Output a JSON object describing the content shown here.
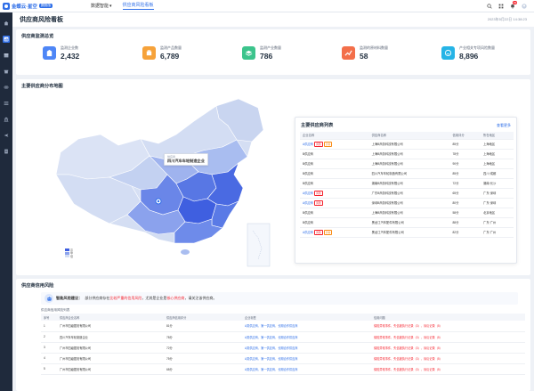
{
  "app": {
    "brand_name": "金蝶云·星空",
    "brand_tag": "旗舰版",
    "nav": [
      {
        "label": "数据智能"
      },
      {
        "label": "供应商风险看板"
      }
    ]
  },
  "header": {
    "title": "供应商风险看板",
    "timestamp": "2023年5月22日 14:38:23",
    "notification_count": "99"
  },
  "overview": {
    "title": "供应商监测总览",
    "stats": [
      {
        "label": "监测企业数",
        "value": "2,432",
        "color": "#4e86f6"
      },
      {
        "label": "监测产品数量",
        "value": "6,789",
        "color": "#f6a23a"
      },
      {
        "label": "监测产业数量",
        "value": "786",
        "color": "#3cc48c"
      },
      {
        "label": "监测的原材料数量",
        "value": "58",
        "color": "#f36f4a"
      },
      {
        "label": "产业相关专项风险数量",
        "value": "8,896",
        "color": "#26b4e6"
      }
    ]
  },
  "map": {
    "title": "主要供应商分布地图",
    "tooltip_title": "供应商",
    "tooltip_name": "四川汽车车轮制造企业",
    "legend": [
      "高",
      "中",
      "低"
    ]
  },
  "supplier_list": {
    "title": "主要供应商列表",
    "more": "查看更多",
    "columns": [
      "企业名称",
      "供应商名称",
      "信用评分",
      "所在地区"
    ],
    "rows": [
      {
        "name": "A供应商",
        "tags": [
          {
            "t": "风险",
            "c": "red"
          },
          {
            "t": "异常",
            "c": "orange"
          }
        ],
        "supplier": "上海B商务科技有限公司",
        "score": "85分",
        "region": "上海地区"
      },
      {
        "name": "B供应商",
        "tags": [],
        "supplier": "上海B商务科技有限公司",
        "score": "78分",
        "region": "上海地区"
      },
      {
        "name": "B供应商",
        "tags": [],
        "supplier": "上海B商务科技有限公司",
        "score": "90分",
        "region": "上海地区"
      },
      {
        "name": "B供应商",
        "tags": [],
        "supplier": "四川汽车车轮制造有限公司",
        "score": "85分",
        "region": "四川·成都"
      },
      {
        "name": "B供应商",
        "tags": [],
        "supplier": "湖南B商务科技有限公司",
        "score": "72分",
        "region": "湖南·长沙"
      },
      {
        "name": "A供应商",
        "tags": [
          {
            "t": "风险",
            "c": "red"
          }
        ],
        "supplier": "广东B商务科技有限公司",
        "score": "65分",
        "region": "广东·深圳"
      },
      {
        "name": "A供应商",
        "tags": [
          {
            "t": "风险",
            "c": "red"
          }
        ],
        "supplier": "深圳B商务科技有限公司",
        "score": "80分",
        "region": "广东·深圳"
      },
      {
        "name": "B供应商",
        "tags": [],
        "supplier": "上海B商务科技有限公司",
        "score": "58分",
        "region": "北京地区"
      },
      {
        "name": "B供应商",
        "tags": [],
        "supplier": "黑龙江汽车配件有限公司",
        "score": "88分",
        "region": "广东·广州"
      },
      {
        "name": "A供应商",
        "tags": [
          {
            "t": "风险",
            "c": "red"
          },
          {
            "t": "异常",
            "c": "orange"
          }
        ],
        "supplier": "黑龙江汽车配件有限公司",
        "score": "82分",
        "region": "广东·广州"
      }
    ]
  },
  "risk": {
    "title": "供应商信用风险",
    "alert_label": "智能风险建议：",
    "alert_text_1": "部分供应商存在",
    "alert_hl_1": "比较严重的信用风险",
    "alert_text_2": "，尤其是企业是",
    "alert_hl_2": "核心供应商",
    "alert_text_3": "，请关注该供应商。",
    "sub_title": "供应商信用风险列表",
    "columns": [
      "序号",
      "供应商企业名称",
      "供应商信用评分",
      "企业标签",
      "信用问题"
    ],
    "rows": [
      {
        "no": "1",
        "name": "广州市四级银安有限公司",
        "score": "81分",
        "tag": "A类供应商、第一供应商、长期合作供应商",
        "issue": "保险异常事件、失信被执行记录（3）、诉讼记录（5）"
      },
      {
        "no": "2",
        "name": "四川汽车车轮制造企业",
        "score": "78分",
        "tag": "A类供应商、第一供应商、长期合作供应商",
        "issue": "保险异常事件、失信被执行记录（3）、诉讼记录（5）"
      },
      {
        "no": "3",
        "name": "广州市四级银安有限公司",
        "score": "72分",
        "tag": "A类供应商、第一供应商、长期合作供应商",
        "issue": "保险异常事件、失信被执行记录（3）、诉讼记录（5）"
      },
      {
        "no": "4",
        "name": "广州市四级银安有限公司",
        "score": "75分",
        "tag": "A类供应商、第一供应商、长期合作供应商",
        "issue": "保险异常事件、失信被执行记录（3）、诉讼记录（5）"
      },
      {
        "no": "5",
        "name": "广州市四级银安有限公司",
        "score": "68分",
        "tag": "A类供应商、第一供应商、长期合作供应商",
        "issue": "保险异常事件、失信被执行记录（3）、诉讼记录（5）"
      }
    ]
  }
}
